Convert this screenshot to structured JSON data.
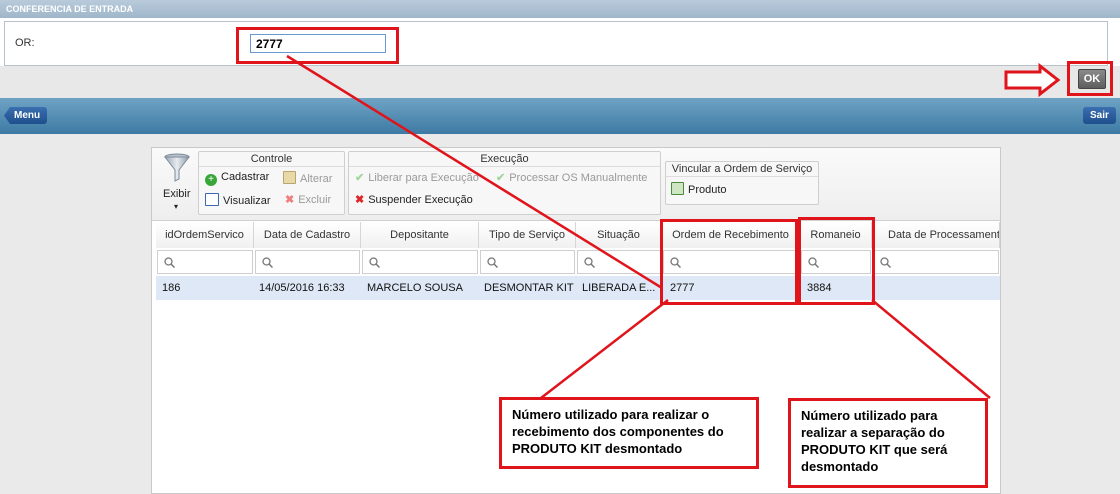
{
  "window": {
    "title": "CONFERENCIA DE ENTRADA"
  },
  "form": {
    "or_label": "OR:",
    "or_value": "2777",
    "ok_label": "OK"
  },
  "nav": {
    "menu_label": "Menu",
    "exit_label": "Sair"
  },
  "ribbon": {
    "exibir_label": "Exibir",
    "controle": {
      "title": "Controle",
      "cadastrar": "Cadastrar",
      "alterar": "Alterar",
      "visualizar": "Visualizar",
      "excluir": "Excluir"
    },
    "execucao": {
      "title": "Execução",
      "liberar": "Liberar para Execução",
      "processar": "Processar OS Manualmente",
      "suspender": "Suspender Execução"
    },
    "vincular": {
      "title": "Vincular a Ordem de Serviço",
      "produto": "Produto"
    }
  },
  "table": {
    "columns": [
      "idOrdemServico",
      "Data de Cadastro",
      "Depositante",
      "Tipo de Serviço",
      "Situação",
      "Ordem de Recebimento",
      "Romaneio",
      "Data de Processamento"
    ],
    "rows": [
      [
        "186",
        "14/05/2016 16:33",
        "MARCELO SOUSA",
        "DESMONTAR KIT",
        "LIBERADA E...",
        "2777",
        "3884",
        ""
      ]
    ]
  },
  "annotations": {
    "note_left": "Número utilizado para realizar o recebimento dos componentes do PRODUTO KIT desmontado",
    "note_right": "Número utilizado para realizar a separação do PRODUTO KIT que será desmontado"
  },
  "colors": {
    "annotation_red": "#e0141b",
    "nav_blue": "#3d7aa4",
    "selected_row": "#dfe8f6"
  }
}
